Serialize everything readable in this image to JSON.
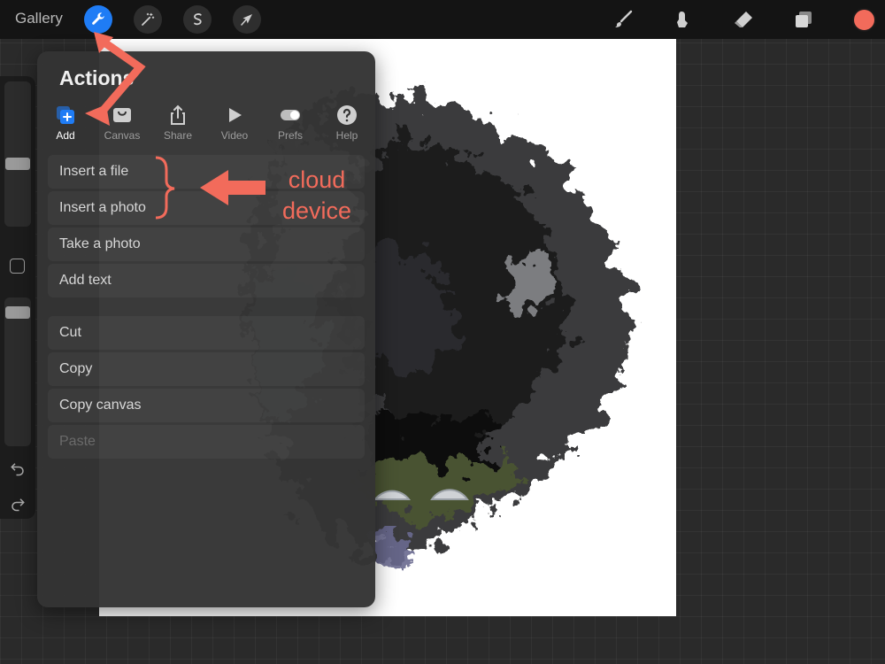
{
  "topbar": {
    "gallery_label": "Gallery",
    "left_tools": [
      "wrench-icon",
      "magic-wand-icon",
      "selection-s-icon",
      "arrow-cursor-icon"
    ],
    "right_tools": [
      "brush-icon",
      "smudge-icon",
      "eraser-icon",
      "layers-icon"
    ],
    "current_color": "#f26b5b",
    "active_color": "#1f7cf5"
  },
  "actions_panel": {
    "title": "Actions",
    "tabs": [
      {
        "label": "Add",
        "icon": "add-plus-icon",
        "active": true
      },
      {
        "label": "Canvas",
        "icon": "canvas-icon",
        "active": false
      },
      {
        "label": "Share",
        "icon": "share-icon",
        "active": false
      },
      {
        "label": "Video",
        "icon": "play-icon",
        "active": false
      },
      {
        "label": "Prefs",
        "icon": "toggle-icon",
        "active": false
      },
      {
        "label": "Help",
        "icon": "help-icon",
        "active": false
      }
    ],
    "group1": [
      {
        "label": "Insert a file",
        "enabled": true
      },
      {
        "label": "Insert a photo",
        "enabled": true
      },
      {
        "label": "Take a photo",
        "enabled": true
      },
      {
        "label": "Add text",
        "enabled": true
      }
    ],
    "group2": [
      {
        "label": "Cut",
        "enabled": true
      },
      {
        "label": "Copy",
        "enabled": true
      },
      {
        "label": "Copy canvas",
        "enabled": true
      },
      {
        "label": "Paste",
        "enabled": false
      }
    ]
  },
  "annotation": {
    "line1": "cloud",
    "line2": "device",
    "color": "#f26b5b"
  }
}
